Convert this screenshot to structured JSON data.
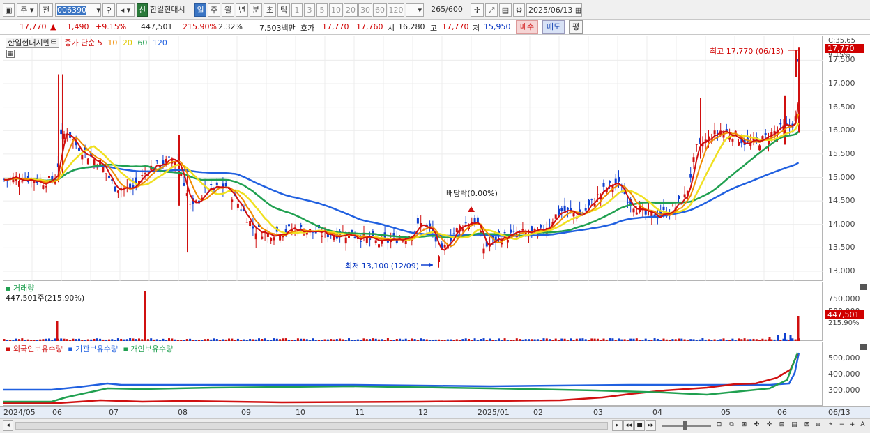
{
  "toolbar": {
    "market": "주",
    "prev": "전",
    "code": "006390",
    "new_badge": "신",
    "stock_name": "한일현대시",
    "periods": [
      "일",
      "주",
      "월",
      "년",
      "분",
      "초",
      "틱"
    ],
    "active_period": "일",
    "intervals": [
      "1",
      "3",
      "5",
      "10",
      "20",
      "30",
      "60",
      "120"
    ],
    "count": "265",
    "count_max": "/600",
    "date": "2025/06/13"
  },
  "quote": {
    "price": "17,770",
    "change": "1,490",
    "change_pct": "+9.15%",
    "volume": "447,501",
    "volume_ratio": "215.90%",
    "turnover": "2.32%",
    "amount": "7,503백만",
    "ask_label": "호가",
    "ask": "17,770",
    "bid": "17,760",
    "open_label": "시",
    "open": "16,280",
    "high_label": "고",
    "high": "17,770",
    "low_label": "저",
    "low": "15,950",
    "buy_label": "매수",
    "sell_label": "매도",
    "avg_label": "평"
  },
  "price_panel": {
    "legend_name": "한일현대시멘트",
    "ma_label": "종가 단순",
    "ma_periods": [
      "5",
      "10",
      "20",
      "60",
      "120"
    ],
    "ma_colors": [
      "#d01010",
      "#f08c00",
      "#f0e020",
      "#20a050",
      "#2060e0"
    ],
    "c_label": "C:35.65",
    "pct_label": "9.15%",
    "current_price": "17,770",
    "high_annotation": "최고 17,770 (06/13)",
    "low_annotation": "최저 13,100 (12/09)",
    "dividend_annotation": "배당락(0.00%)",
    "y_ticks": [
      "17,500",
      "17,000",
      "16,500",
      "16,000",
      "15,500",
      "15,000",
      "14,500",
      "14,000",
      "13,500",
      "13,000"
    ]
  },
  "volume_panel": {
    "legend": "거래량",
    "value_label": "447,501주(215.90%)",
    "y_ticks": [
      "750,000",
      "500,000"
    ],
    "current": "447,501",
    "current_pct": "215.90%"
  },
  "holdings_panel": {
    "legends": [
      "외국인보유수량",
      "기관보유수량",
      "개인보유수량"
    ],
    "legend_colors": [
      "#d01010",
      "#2060e0",
      "#20a050"
    ],
    "y_ticks": [
      "500,000",
      "400,000",
      "300,000"
    ]
  },
  "x_axis": [
    "2024/05",
    "06",
    "07",
    "08",
    "09",
    "10",
    "11",
    "12",
    "2025/01",
    "02",
    "03",
    "04",
    "05",
    "06",
    "06/13"
  ]
}
